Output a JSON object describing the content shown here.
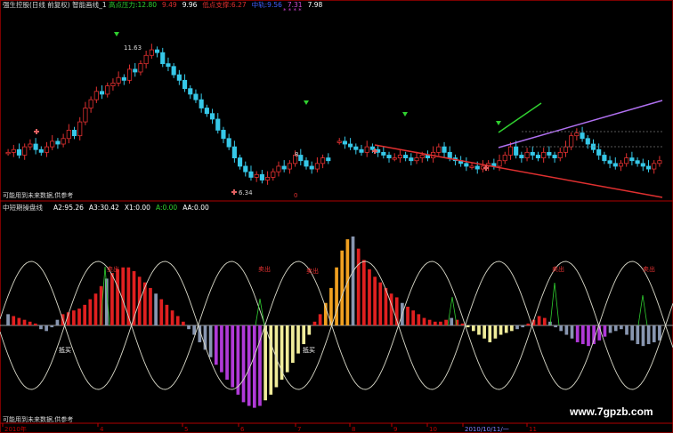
{
  "colors": {
    "background": "#000000",
    "up": "#e03030",
    "down": "#36c8e8",
    "osc_red": "#e02020",
    "osc_steel": "#8896b0",
    "osc_purple": "#b03ad8",
    "osc_yellow": "#f0ec9a",
    "osc_orange": "#f0a020",
    "wave": "#d8d8c8",
    "green_line": "#30d030",
    "violet_line": "#b070f0",
    "red_line": "#e03030",
    "grid": "#c80000"
  },
  "top_panel": {
    "title": "强生控股(日线 前复权) 智能画线_1",
    "items": [
      {
        "label": "高点压力:",
        "value": "12.80",
        "color": "#30d030"
      },
      {
        "value": "9.49",
        "color": "#e03030"
      },
      {
        "value": "9.96",
        "color": "#ffffff"
      },
      {
        "label": "低点支撑:",
        "value": "6.27",
        "color": "#e03030"
      },
      {
        "label": "中轨:",
        "value": "9.56",
        "color": "#4060ff"
      },
      {
        "value": "7.31",
        "color": "#d050d0"
      },
      {
        "value": "7.98",
        "color": "#ffffff"
      }
    ],
    "high_label": "11.63",
    "low_label": "6.34",
    "footnote": "可能用到未来数据,供参考",
    "right_marker": "8",
    "left_marker": "0",
    "top_marks": "* * * *"
  },
  "bottom_panel": {
    "title": "中短期操盘线",
    "items": [
      {
        "label": "A2:",
        "value": "95.26",
        "color": "#ffffff"
      },
      {
        "label": "A3:",
        "value": "30.42",
        "color": "#ffffff"
      },
      {
        "label": "X1:",
        "value": "0.00",
        "color": "#ffffff"
      },
      {
        "label": "A:",
        "value": "0.00",
        "color": "#30d030"
      },
      {
        "label": "AA:",
        "value": "0.00",
        "color": "#ffffff"
      }
    ],
    "sell_label": "卖出",
    "buy_label": "抵买",
    "sell_count": 5,
    "buy_count": 2,
    "footnote": "可能用到未来数据,供参考"
  },
  "time_axis": {
    "ticks": [
      "2010年",
      "4",
      "5",
      "6",
      "7",
      "8",
      "9",
      "10",
      "2010/10/11/一",
      "11"
    ]
  },
  "watermark": "www.7gpzb.com",
  "chart_data": [
    {
      "type": "candlestick",
      "title": "强生控股(日线 前复权)",
      "x": "trading days (approx. 2010-02 to 2010-11)",
      "close": [
        7.4,
        7.5,
        7.3,
        7.6,
        7.7,
        7.5,
        7.4,
        7.6,
        7.8,
        7.7,
        7.9,
        8.2,
        8.0,
        8.5,
        9.0,
        9.3,
        9.6,
        9.5,
        9.8,
        9.9,
        10.1,
        10.0,
        10.4,
        10.3,
        10.6,
        10.9,
        11.1,
        11.0,
        10.6,
        10.5,
        10.2,
        10.0,
        9.7,
        9.5,
        9.3,
        9.0,
        8.8,
        8.6,
        8.2,
        7.9,
        7.6,
        7.2,
        6.9,
        6.7,
        6.5,
        6.6,
        6.4,
        6.5,
        6.7,
        6.9,
        6.8,
        7.0,
        7.3,
        7.1,
        6.9,
        6.8,
        7.0,
        7.2,
        7.1,
        null,
        7.8,
        7.7,
        7.6,
        7.5,
        7.4,
        7.6,
        7.5,
        7.4,
        7.3,
        7.2,
        7.2,
        7.3,
        7.2,
        7.1,
        7.2,
        7.3,
        7.2,
        7.4,
        7.6,
        7.4,
        7.2,
        7.1,
        7.0,
        6.9,
        6.9,
        6.8,
        6.9,
        7.0,
        6.9,
        7.1,
        7.3,
        7.6,
        7.3,
        7.2,
        7.4,
        7.3,
        7.2,
        7.4,
        7.3,
        7.2,
        7.4,
        7.6,
        8.0,
        8.1,
        7.9,
        7.7,
        7.5,
        7.3,
        7.1,
        7.0,
        6.9,
        7.0,
        7.2,
        7.1,
        7.0,
        6.9,
        6.8,
        7.0,
        7.1
      ],
      "high": 11.63,
      "low": 6.34,
      "resistance_high": 12.8,
      "support_low": 6.27,
      "middle_band": 9.56,
      "annotations": [
        "11.63",
        "6.34"
      ]
    },
    {
      "type": "bar",
      "title": "中短期操盘线",
      "values": [
        12,
        10,
        8,
        6,
        4,
        2,
        -4,
        -6,
        -2,
        6,
        12,
        14,
        16,
        18,
        22,
        28,
        34,
        42,
        50,
        56,
        60,
        62,
        62,
        58,
        52,
        46,
        40,
        34,
        28,
        22,
        16,
        10,
        4,
        -4,
        -10,
        -18,
        -26,
        -34,
        -42,
        -50,
        -58,
        -66,
        -74,
        -82,
        -86,
        -88,
        -86,
        -80,
        -74,
        -66,
        -58,
        -50,
        -40,
        -30,
        -20,
        -10,
        4,
        12,
        24,
        40,
        62,
        80,
        92,
        95,
        82,
        70,
        60,
        52,
        46,
        40,
        34,
        30,
        24,
        20,
        16,
        12,
        8,
        6,
        4,
        4,
        6,
        8,
        6,
        2,
        -2,
        -6,
        -10,
        -14,
        -18,
        -14,
        -10,
        -8,
        -6,
        -4,
        -2,
        2,
        6,
        10,
        8,
        4,
        -2,
        -6,
        -10,
        -14,
        -18,
        -20,
        -22,
        -20,
        -16,
        -12,
        -8,
        -6,
        -4,
        -10,
        -16,
        -20,
        -22,
        -20,
        -18,
        -16
      ],
      "annotations": [
        "卖出",
        "抵买"
      ],
      "A2": 95.26,
      "A3": 30.42,
      "X1": 0.0,
      "A": 0.0,
      "AA": 0.0
    }
  ]
}
